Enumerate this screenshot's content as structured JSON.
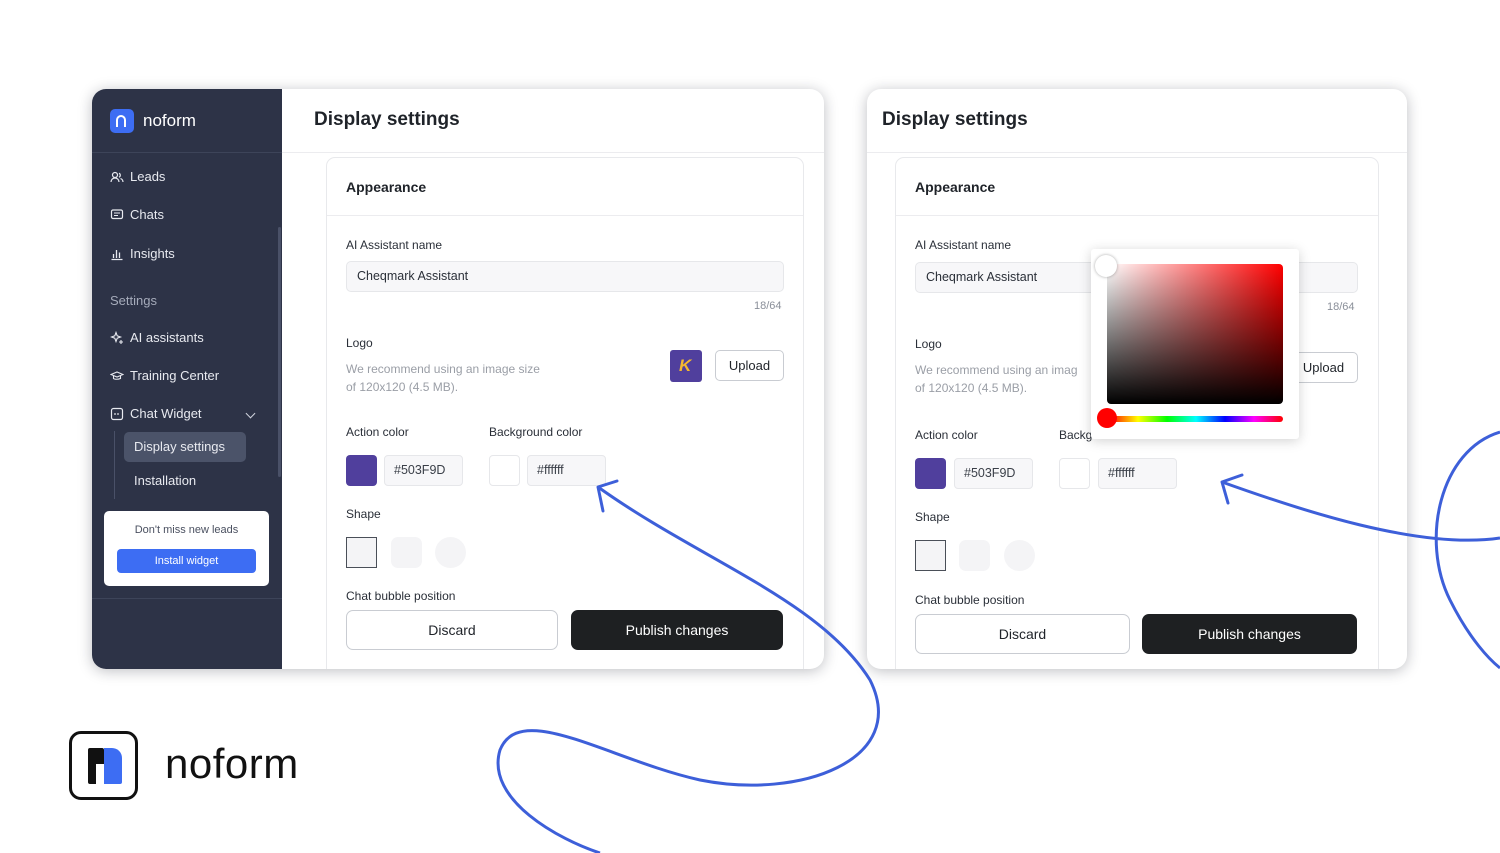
{
  "brand": {
    "name": "noform"
  },
  "sidebar": {
    "items": [
      {
        "label": "Leads",
        "icon": "users-icon"
      },
      {
        "label": "Chats",
        "icon": "chat-icon"
      },
      {
        "label": "Insights",
        "icon": "bar-chart-icon"
      }
    ],
    "section_label": "Settings",
    "settings_items": [
      {
        "label": "AI assistants",
        "icon": "sparkle-icon"
      },
      {
        "label": "Training Center",
        "icon": "graduation-cap-icon"
      },
      {
        "label": "Chat Widget",
        "icon": "widget-icon"
      }
    ],
    "sub_items": [
      {
        "label": "Display settings",
        "active": true
      },
      {
        "label": "Installation",
        "active": false
      }
    ],
    "promo": {
      "text": "Don't miss new leads",
      "button": "Install widget"
    }
  },
  "page": {
    "title": "Display settings",
    "panel_title": "Appearance",
    "assistant_name_label": "AI Assistant name",
    "assistant_name_value": "Cheqmark Assistant",
    "counter": "18/64",
    "logo_label": "Logo",
    "logo_hint_line1": "We recommend using an image size",
    "logo_hint_line2": "of 120x120 (4.5 MB).",
    "logo_hint_right_line1": "We recommend using an imag",
    "upload_button": "Upload",
    "action_color_label": "Action color",
    "background_color_label": "Background color",
    "background_color_label_cut": "Backg",
    "action_color_hex": "#503F9D",
    "background_color_hex": "#ffffff",
    "shape_label": "Shape",
    "bubble_position_label": "Chat bubble position",
    "discard_button": "Discard",
    "publish_button": "Publish changes"
  },
  "colors": {
    "sidebar_bg": "#2d3347",
    "accent": "#3d6df3",
    "action_color": "#503F9D",
    "publish_bg": "#1e2022",
    "annotation_stroke": "#3d5fd9"
  }
}
